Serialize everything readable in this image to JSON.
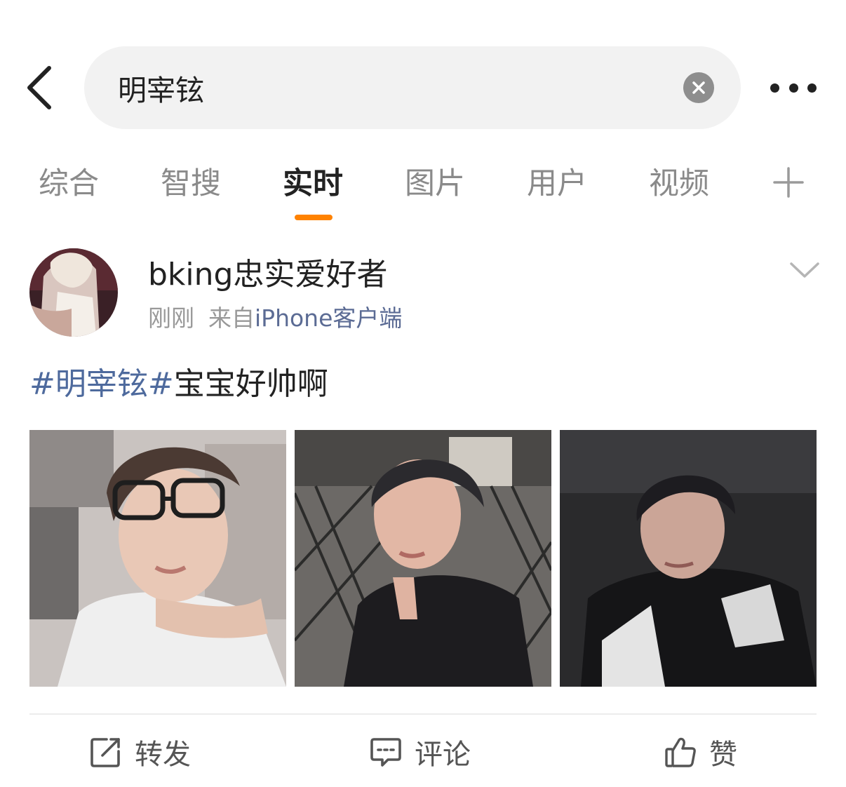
{
  "header": {
    "back_icon": "chevron-left-icon",
    "search_value": "明宰铉",
    "clear_icon": "close-circle-icon",
    "more_icon": "more-horizontal-icon"
  },
  "tabs": [
    {
      "label": "综合",
      "active": false
    },
    {
      "label": "智搜",
      "active": false
    },
    {
      "label": "实时",
      "active": true
    },
    {
      "label": "图片",
      "active": false
    },
    {
      "label": "用户",
      "active": false
    },
    {
      "label": "视频",
      "active": false
    }
  ],
  "tabs_more_icon": "plus-icon",
  "accent_color": "#ff8200",
  "link_color": "#4e6a9d",
  "post": {
    "username": "bking忠实爱好者",
    "time": "刚刚",
    "source_prefix": "来自",
    "source": "iPhone客户端",
    "hashtag": "#明宰铉#",
    "text": "宝宝好帅啊",
    "menu_icon": "chevron-down-icon",
    "photo_count": 3
  },
  "actions": {
    "repost": {
      "label": "转发",
      "icon": "share-box-icon"
    },
    "comment": {
      "label": "评论",
      "icon": "comment-bubble-icon"
    },
    "like": {
      "label": "赞",
      "icon": "thumbs-up-icon"
    }
  }
}
